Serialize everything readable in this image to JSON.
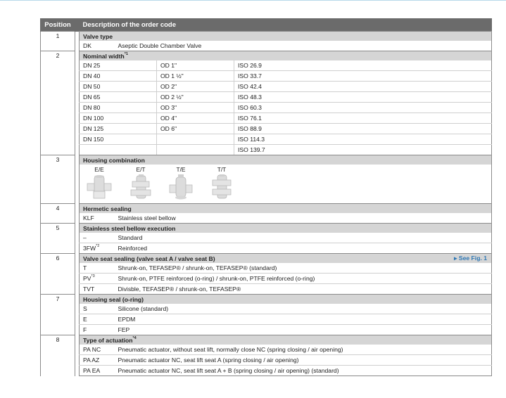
{
  "header": {
    "position": "Position",
    "description": "Description of the order code"
  },
  "sections": {
    "s1": {
      "pos": "1",
      "title": "Valve type",
      "rows": [
        {
          "code": "DK",
          "text": "Aseptic Double Chamber Valve"
        }
      ]
    },
    "s2": {
      "pos": "2",
      "title": "Nominal width",
      "sup": "*1",
      "rows": [
        {
          "dn": "DN 25",
          "od": "OD 1\"",
          "iso": "ISO 26.9"
        },
        {
          "dn": "DN 40",
          "od": "OD 1 ½\"",
          "iso": "ISO 33.7"
        },
        {
          "dn": "DN 50",
          "od": "OD 2\"",
          "iso": "ISO 42.4"
        },
        {
          "dn": "DN 65",
          "od": "OD 2 ½\"",
          "iso": "ISO 48.3"
        },
        {
          "dn": "DN 80",
          "od": "OD 3\"",
          "iso": "ISO 60.3"
        },
        {
          "dn": "DN 100",
          "od": "OD 4\"",
          "iso": "ISO 76.1"
        },
        {
          "dn": "DN 125",
          "od": "OD 6\"",
          "iso": "ISO 88.9"
        },
        {
          "dn": "DN 150",
          "od": "",
          "iso": "ISO 114.3"
        },
        {
          "dn": "",
          "od": "",
          "iso": "ISO 139.7"
        }
      ]
    },
    "s3": {
      "pos": "3",
      "title": "Housing combination",
      "variants": [
        "E/E",
        "E/T",
        "T/E",
        "T/T"
      ]
    },
    "s4": {
      "pos": "4",
      "title": "Hermetic sealing",
      "rows": [
        {
          "code": "KLF",
          "text": "Stainless steel bellow"
        }
      ]
    },
    "s5": {
      "pos": "5",
      "title": "Stainless steel bellow execution",
      "rows": [
        {
          "code": "–",
          "text": "Standard"
        },
        {
          "code": "3FW",
          "sup": "*2",
          "text": "Reinforced"
        }
      ]
    },
    "s6": {
      "pos": "6",
      "title": "Valve seat sealing (valve seat A / valve seat B)",
      "link": "See Fig. 1",
      "rows": [
        {
          "code": "T",
          "text": "Shrunk-on, TEFASEP® / shrunk-on, TEFASEP® (standard)"
        },
        {
          "code": "PV",
          "sup": "*3",
          "text": "Shrunk-on, PTFE reinforced (o-ring) / shrunk-on, PTFE reinforced (o-ring)"
        },
        {
          "code": "TVT",
          "text": "Divisble, TEFASEP® / shrunk-on, TEFASEP®"
        }
      ]
    },
    "s7": {
      "pos": "7",
      "title": "Housing seal (o-ring)",
      "rows": [
        {
          "code": "S",
          "text": "Silicone (standard)"
        },
        {
          "code": "E",
          "text": "EPDM"
        },
        {
          "code": "F",
          "text": "FEP"
        }
      ]
    },
    "s8": {
      "pos": "8",
      "title": "Type of actuation",
      "sup": "*4",
      "rows": [
        {
          "code": "PA NC",
          "text": "Pneumatic actuator, without seat lift, normally close NC (spring closing / air opening)"
        },
        {
          "code": "PA AZ",
          "text": "Pneumatic actuator NC, seat lift seat A (spring closing / air opening)"
        },
        {
          "code": "PA EA",
          "text": "Pneumatic actuator NC, seat lift seat A + B (spring closing / air opening) (standard)"
        }
      ]
    }
  },
  "colors": {
    "header_bg": "#6b6b6b",
    "section_bg": "#d5d5d5",
    "link": "#2e78b5"
  }
}
